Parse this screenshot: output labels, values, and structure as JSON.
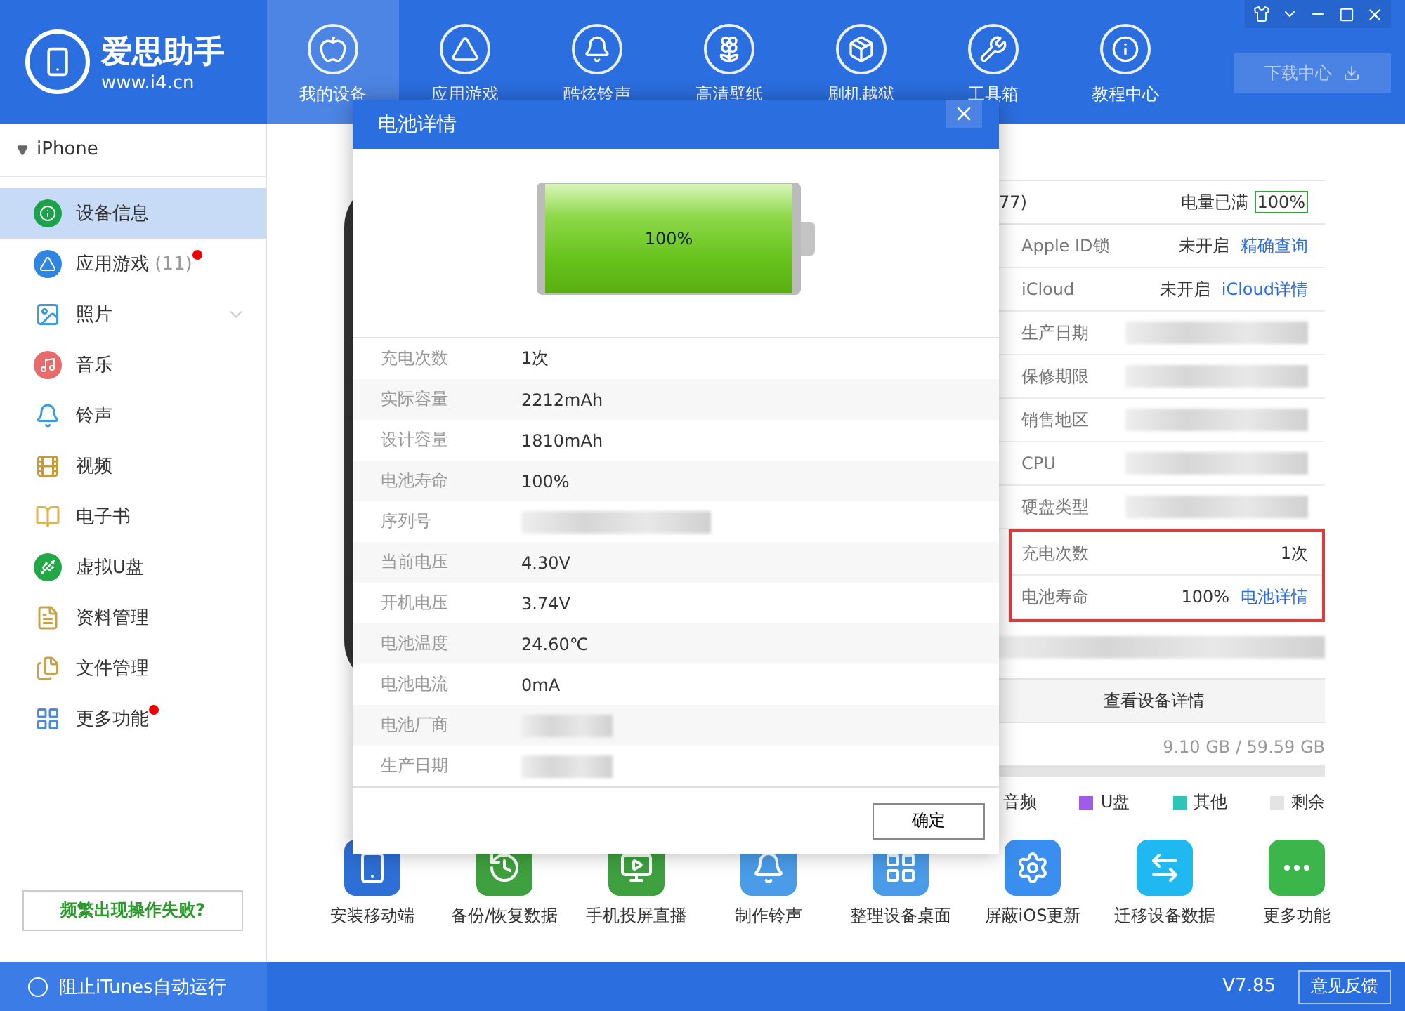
{
  "app": {
    "name": "爱思助手",
    "url": "www.i4.cn"
  },
  "nav": [
    {
      "label": "我的设备",
      "selected": true
    },
    {
      "label": "应用游戏",
      "selected": false
    },
    {
      "label": "酷炫铃声",
      "selected": false
    },
    {
      "label": "高清壁纸",
      "selected": false
    },
    {
      "label": "刷机越狱",
      "selected": false
    },
    {
      "label": "工具箱",
      "selected": false
    },
    {
      "label": "教程中心",
      "selected": false
    }
  ],
  "download_button": "下载中心",
  "sidebar": {
    "device": "iPhone",
    "expanded": true,
    "items": [
      {
        "label": "设备信息",
        "selected": true,
        "badge": false
      },
      {
        "label": "应用游戏",
        "count": "(11)",
        "selected": false,
        "badge": true
      },
      {
        "label": "照片",
        "selected": false,
        "badge": false,
        "expandable": true
      },
      {
        "label": "音乐",
        "selected": false,
        "badge": false
      },
      {
        "label": "铃声",
        "selected": false,
        "badge": false
      },
      {
        "label": "视频",
        "selected": false,
        "badge": false
      },
      {
        "label": "电子书",
        "selected": false,
        "badge": false
      },
      {
        "label": "虚拟U盘",
        "selected": false,
        "badge": false
      },
      {
        "label": "资料管理",
        "selected": false,
        "badge": false
      },
      {
        "label": "文件管理",
        "selected": false,
        "badge": false
      },
      {
        "label": "更多功能",
        "selected": false,
        "badge": true
      }
    ],
    "help_button": "频繁出现操作失败?"
  },
  "device_panel": {
    "header_text": "77)",
    "battery_status": "电量已满",
    "battery_percent": "100%",
    "rows": [
      {
        "label": "Apple ID锁",
        "value": "未开启",
        "link": "精确查询",
        "redacted": false,
        "highlighted": false
      },
      {
        "label": "iCloud",
        "value": "未开启",
        "link": "iCloud详情",
        "redacted": false,
        "highlighted": false
      },
      {
        "label": "生产日期",
        "redacted": true,
        "highlighted": false
      },
      {
        "label": "保修期限",
        "redacted": true,
        "highlighted": false
      },
      {
        "label": "销售地区",
        "redacted": true,
        "highlighted": false
      },
      {
        "label": "CPU",
        "redacted": true,
        "highlighted": false
      },
      {
        "label": "硬盘类型",
        "redacted": true,
        "highlighted": false
      },
      {
        "label": "充电次数",
        "value": "1次",
        "redacted": false,
        "highlighted": true
      },
      {
        "label": "电池寿命",
        "value": "100%",
        "link": "电池详情",
        "redacted": false,
        "highlighted": true
      }
    ],
    "details_button": "查看设备详情",
    "storage": "9.10 GB / 59.59 GB",
    "legend": [
      {
        "label": "音频"
      },
      {
        "label": "U盘",
        "color": "#a05ce8"
      },
      {
        "label": "其他",
        "color": "#2ec4b6"
      },
      {
        "label": "剩余",
        "color": "#e4e4e4"
      }
    ]
  },
  "tools": [
    {
      "label": "安装移动端",
      "color": "#2d6fd6"
    },
    {
      "label": "备份/恢复数据",
      "color": "#3ea03e"
    },
    {
      "label": "手机投屏直播",
      "color": "#3ea03e"
    },
    {
      "label": "制作铃声",
      "color": "#4a9be8"
    },
    {
      "label": "整理设备桌面",
      "color": "#4a9be8"
    },
    {
      "label": "屏蔽iOS更新",
      "color": "#3a8ef0"
    },
    {
      "label": "迁移设备数据",
      "color": "#1fb8f0"
    },
    {
      "label": "更多功能",
      "color": "#3cb54a"
    }
  ],
  "dialog": {
    "title": "电池详情",
    "battery_text": "100%",
    "level": 1,
    "rows": [
      {
        "label": "充电次数",
        "value": "1次",
        "redacted": false
      },
      {
        "label": "实际容量",
        "value": "2212mAh",
        "redacted": false
      },
      {
        "label": "设计容量",
        "value": "1810mAh",
        "redacted": false
      },
      {
        "label": "电池寿命",
        "value": "100%",
        "redacted": false
      },
      {
        "label": "序列号",
        "redacted": true
      },
      {
        "label": "当前电压",
        "value": "4.30V",
        "redacted": false
      },
      {
        "label": "开机电压",
        "value": "3.74V",
        "redacted": false
      },
      {
        "label": "电池温度",
        "value": "24.60℃",
        "redacted": false
      },
      {
        "label": "电池电流",
        "value": "0mA",
        "redacted": false
      },
      {
        "label": "电池厂商",
        "redacted": true
      },
      {
        "label": "生产日期",
        "redacted": true
      }
    ],
    "ok_button": "确定"
  },
  "status_bar": {
    "itunes_toggle": "阻止iTunes自动运行",
    "checked": false,
    "version": "V7.85",
    "feedback_button": "意见反馈"
  }
}
